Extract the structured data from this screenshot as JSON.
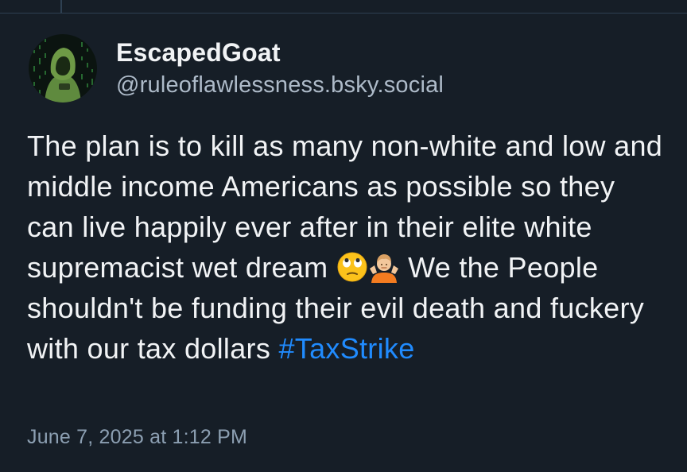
{
  "post": {
    "author": {
      "display_name": "EscapedGoat",
      "handle": "@ruleoflawlessness.bsky.social",
      "avatar_icon": "hooded-hacker-avatar"
    },
    "text_before_emoji": "The plan is to kill as many non-white and low and middle income Americans as possible so they can live happily ever after in their elite white supremacist wet dream",
    "emojis": [
      "eye-roll-emoji",
      "shrug-emoji"
    ],
    "text_after_emoji": "We the People shouldn't be funding their evil death and fuckery with our tax dollars",
    "hashtag": "#TaxStrike",
    "timestamp": "June 7, 2025 at 1:12 PM"
  },
  "colors": {
    "background": "#161e27",
    "text": "#f1f3f5",
    "muted": "#8c9fb2",
    "link": "#208bfe"
  }
}
